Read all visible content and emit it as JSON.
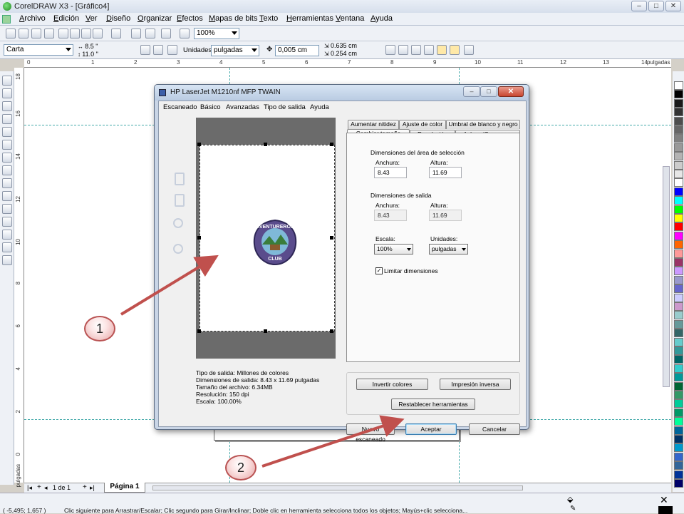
{
  "app": {
    "title": "CorelDRAW X3 - [Gráfico4]",
    "window_buttons": [
      "–",
      "□",
      "✕"
    ]
  },
  "menubar": [
    "Archivo",
    "Edición",
    "Ver",
    "Diseño",
    "Organizar",
    "Efectos",
    "Mapas de bits",
    "Texto",
    "Herramientas",
    "Ventana",
    "Ayuda"
  ],
  "toolbar1": {
    "zoom": "100%"
  },
  "toolbar2": {
    "paper": "Carta",
    "width": "8.5 \"",
    "height": "11.0 \"",
    "units_label": "Unidades:",
    "units": "pulgadas",
    "nudge": "0,005 cm",
    "dup_x": "0.635 cm",
    "dup_y": "0.254 cm"
  },
  "ruler": {
    "top_labels": [
      "0",
      "1",
      "2",
      "3",
      "4",
      "5",
      "6",
      "7",
      "8",
      "9",
      "10",
      "11",
      "12",
      "13",
      "14"
    ],
    "unit": "pulgadas",
    "left_labels": [
      "18",
      "16",
      "14",
      "12",
      "10",
      "8",
      "6",
      "4",
      "2",
      "0",
      "2"
    ]
  },
  "pagetabs": {
    "counter": "1 de 1",
    "page": "Página 1"
  },
  "statusbar": {
    "coords": "( -5,495; 1,657 )",
    "message": "Clic siguiente para Arrastrar/Escalar; Clic segundo para Girar/Inclinar; Doble clic en herramienta selecciona todos los objetos; Mayús+clic selecciona..."
  },
  "dialog": {
    "title": "HP LaserJet M1210nf MFP TWAIN",
    "menu": [
      "Escaneado",
      "Básico",
      "Avanzadas",
      "Tipo de salida",
      "Ayuda"
    ],
    "tabs_back": [
      "Aumentar nitidez",
      "Ajuste de color",
      "Umbral de blanco y negro"
    ],
    "tabs_front": [
      "Cambiar tamaño",
      "Resolución",
      "Aclarar/Oscurecer"
    ],
    "sel_area_title": "Dimensiones del área de selección",
    "width_label": "Anchura:",
    "height_label": "Altura:",
    "sel_width": "8.43",
    "sel_height": "11.69",
    "out_title": "Dimensiones de salida",
    "out_width": "8.43",
    "out_height": "11.69",
    "scale_label": "Escala:",
    "scale": "100%",
    "units_label": "Unidades:",
    "units": "pulgadas",
    "limit_label": "Limitar dimensiones",
    "btn_invert": "Invertir colores",
    "btn_reverse": "Impresión inversa",
    "btn_reset": "Restablecer herramientas",
    "btn_new": "Nuevo escaneado",
    "btn_accept": "Aceptar",
    "btn_cancel": "Cancelar",
    "info": {
      "output_type": "Tipo de salida:  Millones de colores",
      "output_dims": "Dimensiones de salida:  8.43 x 11.69 pulgadas",
      "file_size": "Tamaño del archivo:  6.34MB",
      "resolution": "Resolución:  150 dpi",
      "scale": "Escala:  100.00%"
    },
    "logo_top": "AVENTUREROS",
    "logo_bottom": "CLUB"
  },
  "callouts": [
    "1",
    "2"
  ],
  "colors": {
    "arrow": "#c0504d",
    "palette": [
      "#ffffff",
      "#000000",
      "#1a1a1a",
      "#333333",
      "#4d4d4d",
      "#666666",
      "#808080",
      "#999999",
      "#b3b3b3",
      "#cccccc",
      "#e6e6e6",
      "#ffffff",
      "#0000ff",
      "#00ffff",
      "#00ff00",
      "#ffff00",
      "#ff0000",
      "#ff00ff",
      "#ff6600",
      "#ff9999",
      "#993366",
      "#cc99ff",
      "#9999cc",
      "#6666cc",
      "#ccccff",
      "#cc99cc",
      "#99cccc",
      "#669999",
      "#336666",
      "#66cccc",
      "#339999",
      "#006666",
      "#33cccc",
      "#009999",
      "#006633",
      "#339966",
      "#00cc99",
      "#009966",
      "#00ff99",
      "#006699",
      "#003366",
      "#0099cc",
      "#3366cc",
      "#336699",
      "#003399",
      "#000066"
    ]
  }
}
